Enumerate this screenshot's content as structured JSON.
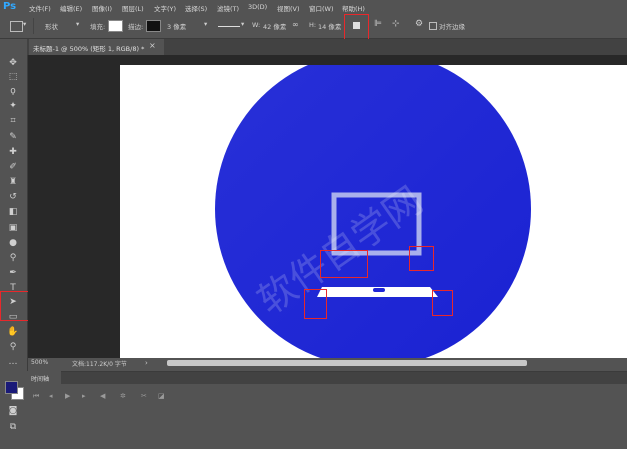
{
  "app": {
    "logo": "Ps"
  },
  "menu": [
    "文件(F)",
    "编辑(E)",
    "图像(I)",
    "图层(L)",
    "文字(Y)",
    "选择(S)",
    "滤镜(T)",
    "3D(D)",
    "视图(V)",
    "窗口(W)",
    "帮助(H)"
  ],
  "options": {
    "shape_mode": "形状",
    "fill_label": "填充:",
    "stroke_label": "描边:",
    "stroke_width": "3 像素",
    "width_label": "W:",
    "width_value": "42 像素",
    "height_label": "H:",
    "height_value": "14 像素",
    "align_edges": "对齐边缘"
  },
  "document": {
    "tab_title": "未标题-1 @ 500% (矩形 1, RGB/8) *"
  },
  "status": {
    "zoom": "500%",
    "doc_info": "文档:117.2K/0 字节"
  },
  "timeline": {
    "label": "时间轴"
  },
  "colors": {
    "foreground": "#1a1a78",
    "background": "#ffffff",
    "circle": "#1f25d6",
    "highlight": "#e8282b"
  }
}
